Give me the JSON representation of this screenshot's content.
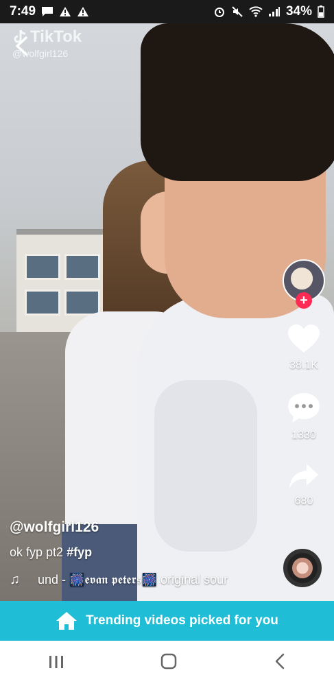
{
  "status": {
    "time": "7:49",
    "battery": "34%"
  },
  "watermark": {
    "logo": "TikTok",
    "handle": "@wolfgirl126"
  },
  "actions": {
    "likes": "38.1K",
    "comments": "1330",
    "shares": "680"
  },
  "caption": {
    "username": "@wolfgirl126",
    "text": "ok fyp pt2",
    "hashtag": "#fyp",
    "music": "und - 🎆𝖊𝖛𝖆𝖓 𝖕𝖊𝖙𝖊𝖗𝖘🎆   original sour"
  },
  "banner": {
    "label": "Trending videos picked for you"
  },
  "colors": {
    "banner": "#20bdd6",
    "follow": "#fe2c55"
  },
  "icons": [
    "back-icon",
    "heart-icon",
    "comment-icon",
    "share-icon",
    "music-note-icon",
    "home-icon",
    "recents-icon",
    "home-nav-icon",
    "back-nav-icon"
  ]
}
